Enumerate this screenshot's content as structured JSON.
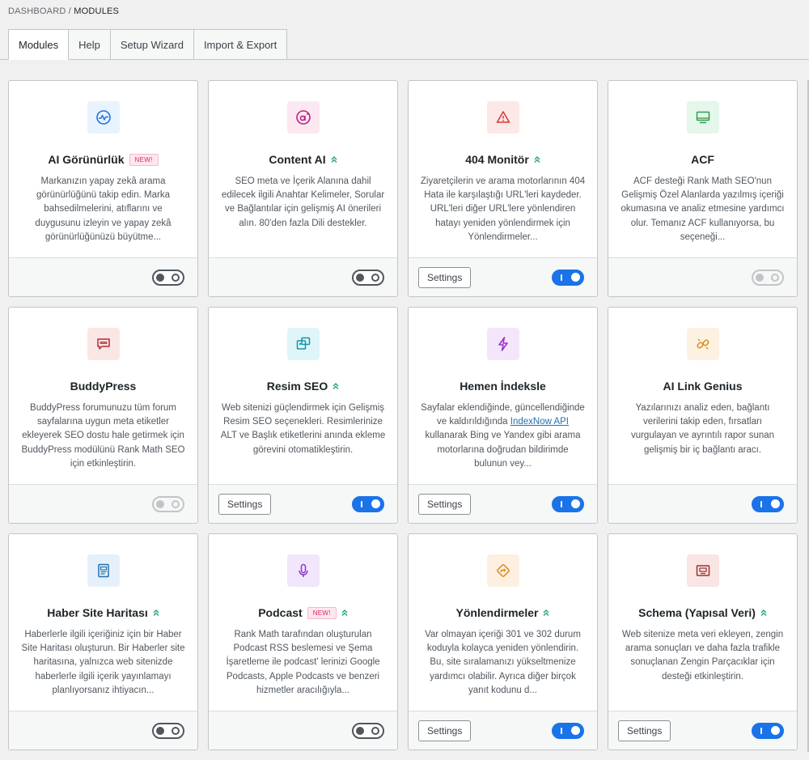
{
  "breadcrumb": {
    "parent": "DASHBOARD",
    "sep": "/",
    "current": "MODULES"
  },
  "tabs": [
    "Modules",
    "Help",
    "Setup Wizard",
    "Import & Export"
  ],
  "settings_label": "Settings",
  "new_label": "NEW!",
  "modules": [
    {
      "title": "AI Görünürlük",
      "icon": "ai-visibility-icon",
      "icon_color": "#1a73e8",
      "icon_bg": "#e8f3fd",
      "new": true,
      "pro": false,
      "desc": "Markanızın yapay zekâ arama görünürlüğünü takip edin. Marka bahsedilmelerini, atıflarını ve duygusunu izleyin ve yapay zekâ görünürlüğünüzü büyütme...",
      "settings": false,
      "state": "off"
    },
    {
      "title": "Content AI",
      "icon": "content-ai-icon",
      "icon_color": "#c21f8a",
      "icon_bg": "#fce8f1",
      "new": false,
      "pro": true,
      "desc": "SEO meta ve İçerik Alanına dahil edilecek ilgili Anahtar Kelimeler, Sorular ve Bağlantılar için gelişmiş AI önerileri alın. 80'den fazla Dili destekler.",
      "settings": false,
      "state": "off"
    },
    {
      "title": "404 Monitör",
      "icon": "warning-icon",
      "icon_color": "#d63638",
      "icon_bg": "#fde8e8",
      "new": false,
      "pro": true,
      "desc": "Ziyaretçilerin ve arama motorlarının 404 Hata ile karşılaştığı URL'leri kaydeder. URL'leri diğer URL'lere yönlendiren hatayı yeniden yönlendirmek için Yönlendirmeler...",
      "settings": true,
      "state": "on"
    },
    {
      "title": "ACF",
      "icon": "monitor-icon",
      "icon_color": "#2e9e4c",
      "icon_bg": "#e5f6ea",
      "new": false,
      "pro": false,
      "desc": "ACF desteği Rank Math SEO'nun Gelişmiş Özel Alanlarda yazılmış içeriği okumasına ve analiz etmesine yardımcı olur. Temanız ACF kullanıyorsa, bu seçeneği...",
      "settings": false,
      "state": "disabled"
    },
    {
      "title": "BuddyPress",
      "icon": "chat-bubble-icon",
      "icon_color": "#b32d2e",
      "icon_bg": "#fbe6e6",
      "new": false,
      "pro": false,
      "desc": "BuddyPress forumunuzu tüm forum sayfalarına uygun meta etiketler ekleyerek SEO dostu hale getirmek için BuddyPress modülünü Rank Math SEO için etkinleştirin.",
      "settings": false,
      "state": "disabled"
    },
    {
      "title": "Resim SEO",
      "icon": "images-icon",
      "icon_color": "#1993a8",
      "icon_bg": "#e0f5f8",
      "new": false,
      "pro": true,
      "desc": "Web sitenizi güçlendirmek için Gelişmiş Resim SEO seçenekleri. Resimlerinize ALT ve Başlık etiketlerini anında ekleme görevini otomatikleştirin.",
      "settings": true,
      "state": "on"
    },
    {
      "title": "Hemen İndeksle",
      "icon": "lightning-icon",
      "icon_color": "#9b2fc7",
      "icon_bg": "#f3e6fa",
      "new": false,
      "pro": false,
      "desc_before": "Sayfalar eklendiğinde, güncellendiğinde ve kaldırıldığında ",
      "desc_link": "IndexNow API",
      "desc_after": " kullanarak Bing ve Yandex gibi arama motorlarına doğrudan bildirimde bulunun vey...",
      "settings": true,
      "state": "on"
    },
    {
      "title": "AI Link Genius",
      "icon": "link-icon",
      "icon_color": "#d98b1b",
      "icon_bg": "#fdf1e1",
      "new": false,
      "pro": false,
      "desc": "Yazılarınızı analiz eden, bağlantı verilerini takip eden, fırsatları vurgulayan ve ayrıntılı rapor sunan gelişmiş bir iç bağlantı aracı.",
      "settings": false,
      "state": "on"
    },
    {
      "title": "Haber Site Haritası",
      "icon": "news-icon",
      "icon_color": "#2271b1",
      "icon_bg": "#e6f0fa",
      "new": false,
      "pro": true,
      "desc": "Haberlerle ilgili içeriğiniz için bir Haber Site Haritası oluşturun. Bir Haberler site haritasına, yalnızca web sitenizde haberlerle ilgili içerik yayınlamayı planlıyorsanız ihtiyacın...",
      "settings": false,
      "state": "off"
    },
    {
      "title": "Podcast",
      "icon": "microphone-icon",
      "icon_color": "#8a35c9",
      "icon_bg": "#f1e6fb",
      "new": true,
      "pro": true,
      "desc": "Rank Math tarafından oluşturulan Podcast RSS beslemesi ve Şema İşaretleme ile podcast' lerinizi Google Podcasts, Apple Podcasts ve benzeri hizmetler aracılığıyla...",
      "settings": false,
      "state": "off"
    },
    {
      "title": "Yönlendirmeler",
      "icon": "redirect-icon",
      "icon_color": "#e0891f",
      "icon_bg": "#fdf0e0",
      "new": false,
      "pro": true,
      "desc": "Var olmayan içeriği 301 ve 302 durum koduyla kolayca yeniden yönlendirin. Bu, site sıralamanızı yükseltmenize yardımcı olabilir. Ayrıca diğer birçok yanıt kodunu d...",
      "settings": true,
      "state": "on"
    },
    {
      "title": "Schema (Yapısal Veri)",
      "icon": "schema-icon",
      "icon_color": "#a0312e",
      "icon_bg": "#f8e5e4",
      "new": false,
      "pro": true,
      "desc": "Web sitenize meta veri ekleyen, zengin arama sonuçları ve daha fazla trafikle sonuçlanan Zengin Parçacıklar için desteği etkinleştirin.",
      "settings": true,
      "state": "on"
    }
  ]
}
